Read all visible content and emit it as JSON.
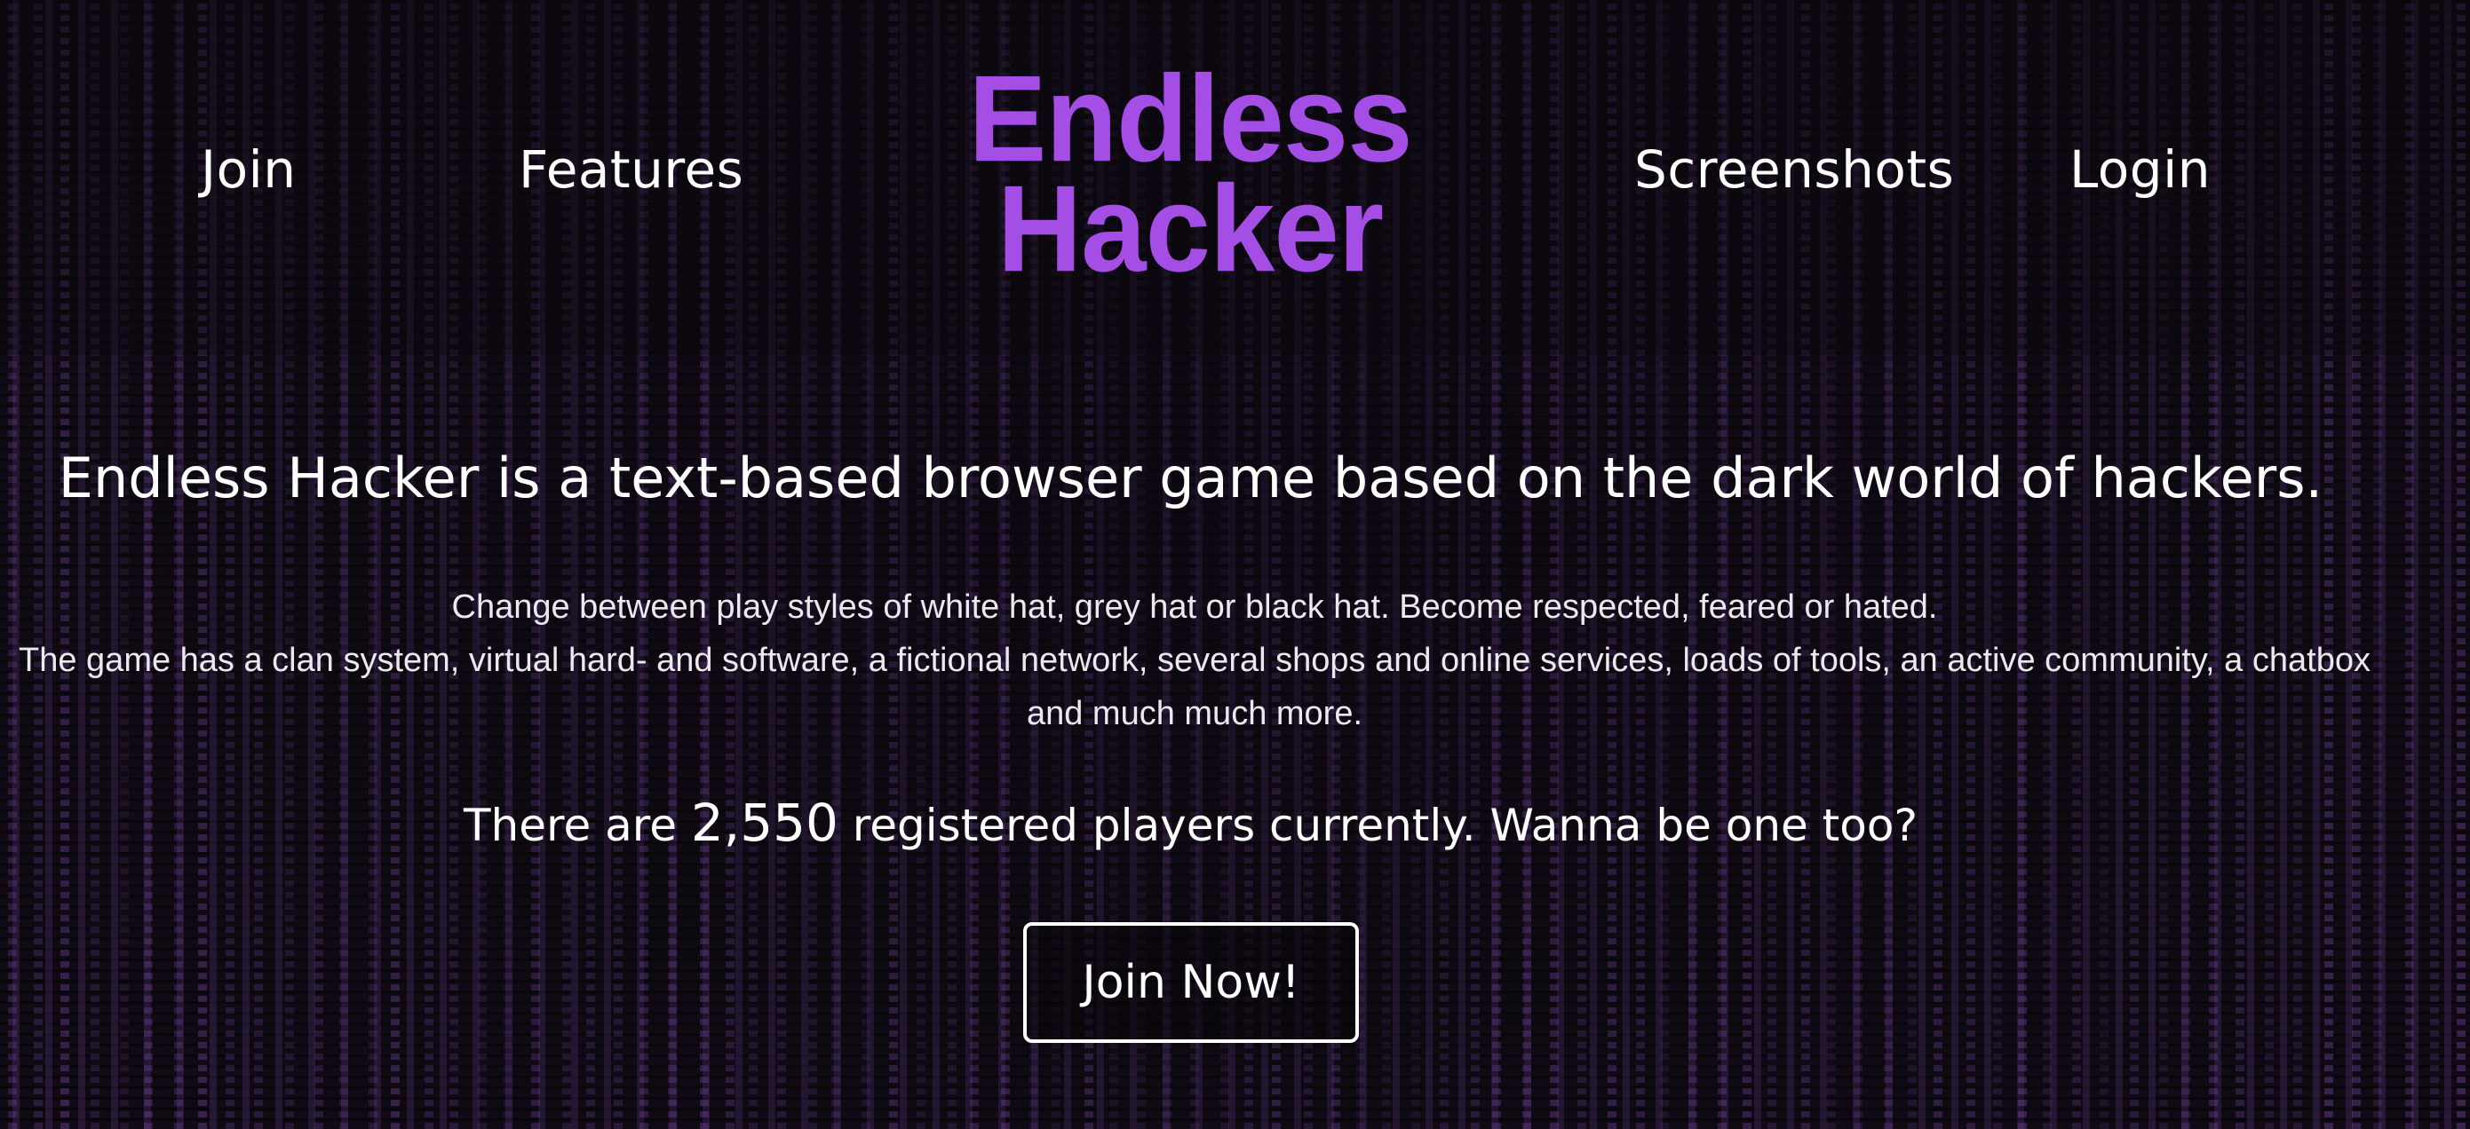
{
  "nav": {
    "join": "Join",
    "features": "Features",
    "screenshots": "Screenshots",
    "login": "Login"
  },
  "logo": {
    "line1": "Endless",
    "line2": "Hacker",
    "color": "#a54ee6"
  },
  "hero": {
    "headline": "Endless Hacker is a text-based browser game based on the dark world of hackers.",
    "description_line1": "Change between play styles of white hat, grey hat or black hat. Become respected, feared or hated.",
    "description_line2": "The game has a clan system, virtual hard- and software, a fictional network, several shops and online services, loads of tools, an active community, a chatbox and much much more.",
    "players_prefix": "There are ",
    "players_count": "2,550",
    "players_suffix": " registered players currently. Wanna be one too?",
    "cta_label": "Join Now!"
  },
  "colors": {
    "background": "#100b14",
    "accent": "#a54ee6",
    "text": "#ffffff"
  }
}
